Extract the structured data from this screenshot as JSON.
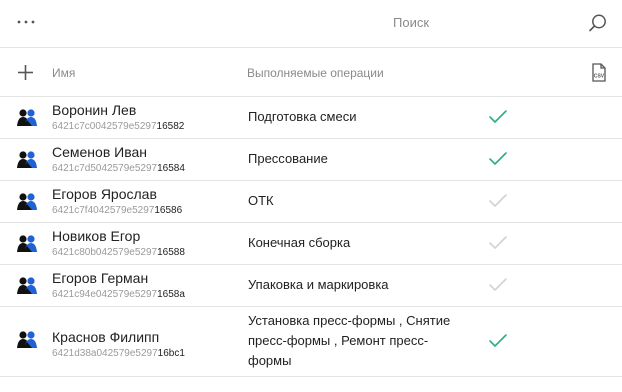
{
  "topbar": {
    "search_label": "Поиск"
  },
  "table": {
    "col_name": "Имя",
    "col_ops": "Выполняемые операции",
    "csv_label": "CSV"
  },
  "colors": {
    "accent_check": "#2fae7f",
    "inactive_check": "#d3d3d3",
    "avatar_dark": "#111111",
    "avatar_blue": "#1e62d6"
  },
  "rows": [
    {
      "name": "Воронин Лев",
      "uid_prefix": "6421c7c0042579e5297",
      "uid_tail": "16582",
      "ops": "Подготовка смеси",
      "active": true
    },
    {
      "name": "Семенов Иван",
      "uid_prefix": "6421c7d5042579e5297",
      "uid_tail": "16584",
      "ops": "Прессование",
      "active": true
    },
    {
      "name": "Егоров Ярослав",
      "uid_prefix": "6421c7f4042579e5297",
      "uid_tail": "16586",
      "ops": "ОТК",
      "active": false
    },
    {
      "name": "Новиков Егор",
      "uid_prefix": "6421c80b042579e5297",
      "uid_tail": "16588",
      "ops": "Конечная сборка",
      "active": false
    },
    {
      "name": "Егоров Герман",
      "uid_prefix": "6421c94e042579e5297",
      "uid_tail": "1658a",
      "ops": "Упаковка и маркировка",
      "active": false
    },
    {
      "name": "Краснов Филипп",
      "uid_prefix": "6421d38a042579e5297",
      "uid_tail": "16bc1",
      "ops": "Установка пресс-формы , Снятие пресс-формы , Ремонт пресс-формы",
      "active": true
    }
  ]
}
